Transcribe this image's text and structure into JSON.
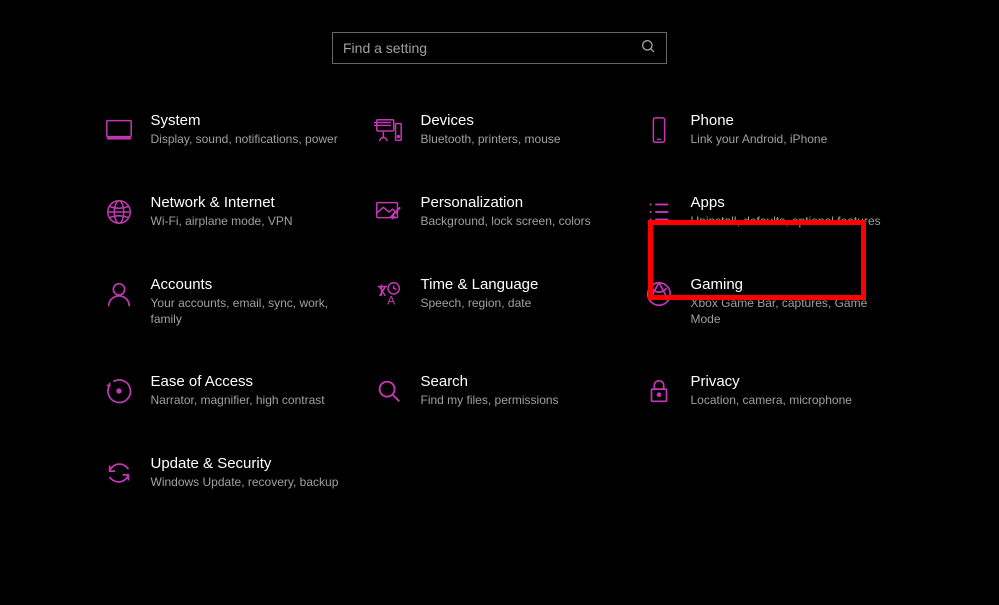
{
  "search": {
    "placeholder": "Find a setting"
  },
  "tiles": {
    "system": {
      "title": "System",
      "desc": "Display, sound, notifications, power"
    },
    "devices": {
      "title": "Devices",
      "desc": "Bluetooth, printers, mouse"
    },
    "phone": {
      "title": "Phone",
      "desc": "Link your Android, iPhone"
    },
    "network": {
      "title": "Network & Internet",
      "desc": "Wi-Fi, airplane mode, VPN"
    },
    "personalization": {
      "title": "Personalization",
      "desc": "Background, lock screen, colors"
    },
    "apps": {
      "title": "Apps",
      "desc": "Uninstall, defaults, optional features"
    },
    "accounts": {
      "title": "Accounts",
      "desc": "Your accounts, email, sync, work, family"
    },
    "time": {
      "title": "Time & Language",
      "desc": "Speech, region, date"
    },
    "gaming": {
      "title": "Gaming",
      "desc": "Xbox Game Bar, captures, Game Mode"
    },
    "ease": {
      "title": "Ease of Access",
      "desc": "Narrator, magnifier, high contrast"
    },
    "searchTile": {
      "title": "Search",
      "desc": "Find my files, permissions"
    },
    "privacy": {
      "title": "Privacy",
      "desc": "Location, camera, microphone"
    },
    "update": {
      "title": "Update & Security",
      "desc": "Windows Update, recovery, backup"
    }
  },
  "accent": "#c239b3"
}
